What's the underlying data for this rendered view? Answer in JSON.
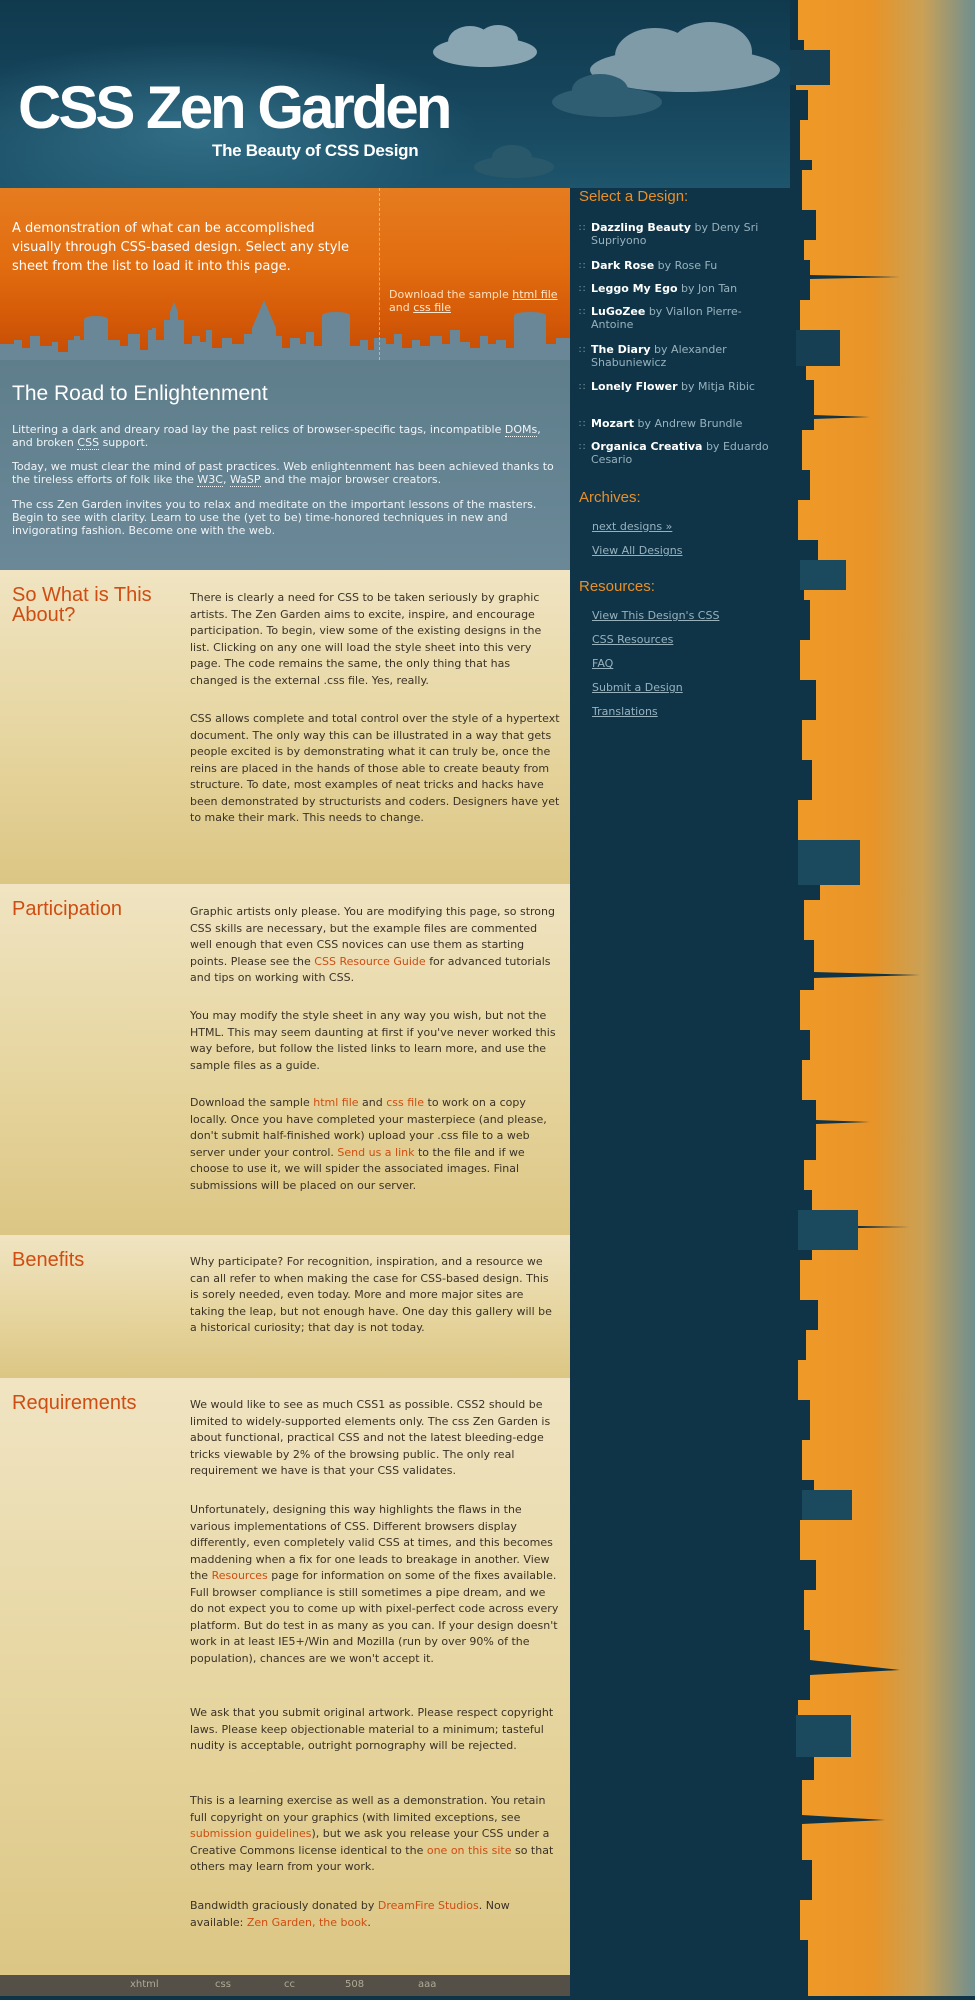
{
  "header": {
    "title": "CSS Zen Garden",
    "tagline": "The Beauty of CSS Design"
  },
  "intro": {
    "summary": "A demonstration of what can be accomplished visually through CSS-based design. Select any style sheet from the list to load it into this page.",
    "download_prefix": "Download the sample",
    "html_file": "html file",
    "and": "and",
    "css_file": "css file"
  },
  "preamble": {
    "heading": "The Road to Enlightenment",
    "p1_a": "Littering a dark and dreary road lay the past relics of browser-specific tags, incompatible",
    "p1_doms": "DOMs",
    "p1_b": ", and broken",
    "p1_css": "CSS",
    "p1_c": "support.",
    "p2_a": "Today, we must clear the mind of past practices. Web enlightenment has been achieved thanks to the tireless efforts of folk like the",
    "p2_w3c": "W3C",
    "p2_b": ",",
    "p2_wasp": "WaSP",
    "p2_c": "and the major browser creators.",
    "p3": "The css Zen Garden invites you to relax and meditate on the important lessons of the masters. Begin to see with clarity. Learn to use the (yet to be) time-honored techniques in new and invigorating fashion. Become one with the web."
  },
  "explanation": {
    "heading": "So What is This About?",
    "p1": "There is clearly a need for CSS to be taken seriously by graphic artists. The Zen Garden aims to excite, inspire, and encourage participation. To begin, view some of the existing designs in the list. Clicking on any one will load the style sheet into this very page. The code remains the same, the only thing that has changed is the external .css file. Yes, really.",
    "p2": "CSS allows complete and total control over the style of a hypertext document. The only way this can be illustrated in a way that gets people excited is by demonstrating what it can truly be, once the reins are placed in the hands of those able to create beauty from structure. To date, most examples of neat tricks and hacks have been demonstrated by structurists and coders. Designers have yet to make their mark. This needs to change."
  },
  "participation": {
    "heading": "Participation",
    "p1_a": "Graphic artists only please. You are modifying this page, so strong CSS skills are necessary, but the example files are commented well enough that even CSS novices can use them as starting points. Please see the",
    "p1_link": "CSS Resource Guide",
    "p1_b": "for advanced tutorials and tips on working with CSS.",
    "p2": "You may modify the style sheet in any way you wish, but not the HTML. This may seem daunting at first if you've never worked this way before, but follow the listed links to learn more, and use the sample files as a guide.",
    "p3_a": "Download the sample",
    "p3_html": "html file",
    "p3_and": "and",
    "p3_css": "css file",
    "p3_b": "to work on a copy locally. Once you have completed your masterpiece (and please, don't submit half-finished work) upload your .css file to a web server under your control.",
    "p3_send": "Send us a link",
    "p3_c": "to the file and if we choose to use it, we will spider the associated images. Final submissions will be placed on our server."
  },
  "benefits": {
    "heading": "Benefits",
    "p1": "Why participate? For recognition, inspiration, and a resource we can all refer to when making the case for CSS-based design. This is sorely needed, even today. More and more major sites are taking the leap, but not enough have. One day this gallery will be a historical curiosity; that day is not today."
  },
  "requirements": {
    "heading": "Requirements",
    "p1": "We would like to see as much CSS1 as possible. CSS2 should be limited to widely-supported elements only. The css Zen Garden is about functional, practical CSS and not the latest bleeding-edge tricks viewable by 2% of the browsing public. The only real requirement we have is that your CSS validates.",
    "p2_a": "Unfortunately, designing this way highlights the flaws in the various implementations of CSS. Different browsers display differently, even completely valid CSS at times, and this becomes maddening when a fix for one leads to breakage in another. View the",
    "p2_link": "Resources",
    "p2_b": "page for information on some of the fixes available. Full browser compliance is still sometimes a pipe dream, and we do not expect you to come up with pixel-perfect code across every platform. But do test in as many as you can. If your design doesn't work in at least IE5+/Win and Mozilla (run by over 90% of the population), chances are we won't accept it.",
    "p3": "We ask that you submit original artwork. Please respect copyright laws. Please keep objectionable material to a minimum; tasteful nudity is acceptable, outright pornography will be rejected.",
    "p4_a": "This is a learning exercise as well as a demonstration. You retain full copyright on your graphics (with limited exceptions, see",
    "p4_link1": "submission guidelines",
    "p4_b": "), but we ask you release your CSS under a Creative Commons license identical to the",
    "p4_link2": "one on this site",
    "p4_c": "so that others may learn from your work.",
    "p5_a": "Bandwidth graciously donated by",
    "p5_link1": "DreamFire Studios",
    "p5_b": ". Now available:",
    "p5_link2": "Zen Garden, the book",
    "p5_c": "."
  },
  "footer": {
    "links": [
      "xhtml",
      "css",
      "cc",
      "508",
      "aaa"
    ]
  },
  "sidebar": {
    "select_heading": "Select a Design:",
    "by": "by",
    "designs": [
      {
        "name": "Dazzling Beauty",
        "author": "Deny Sri Supriyono"
      },
      {
        "name": "Dark Rose",
        "author": "Rose Fu"
      },
      {
        "name": "Leggo My Ego",
        "author": "Jon Tan"
      },
      {
        "name": "LuGoZee",
        "author": "Viallon Pierre-Antoine"
      },
      {
        "name": "The Diary",
        "author": "Alexander Shabuniewicz"
      },
      {
        "name": "Lonely Flower",
        "author": "Mitja Ribic"
      },
      {
        "name": "Mozart",
        "author": "Andrew Brundle"
      },
      {
        "name": "Organica Creativa",
        "author": "Eduardo Cesario"
      }
    ],
    "archives_heading": "Archives:",
    "archives": [
      "next designs »",
      "View All Designs"
    ],
    "resources_heading": "Resources:",
    "resources": [
      "View This Design's CSS",
      "CSS Resources",
      "FAQ",
      "Submit a Design",
      "Translations"
    ]
  },
  "colors": {
    "navy": "#0f3447",
    "orange": "#e2700f",
    "accent_text": "#cf4d12",
    "beige": "#e6d59f",
    "slate": "#64838f"
  }
}
